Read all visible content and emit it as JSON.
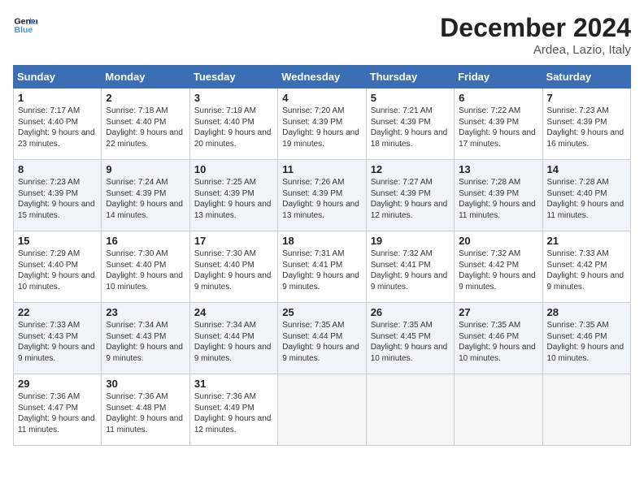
{
  "header": {
    "logo_line1": "General",
    "logo_line2": "Blue",
    "month_title": "December 2024",
    "location": "Ardea, Lazio, Italy"
  },
  "days_of_week": [
    "Sunday",
    "Monday",
    "Tuesday",
    "Wednesday",
    "Thursday",
    "Friday",
    "Saturday"
  ],
  "weeks": [
    [
      {
        "day": 1,
        "sunrise": "7:17 AM",
        "sunset": "4:40 PM",
        "daylight": "9 hours and 23 minutes."
      },
      {
        "day": 2,
        "sunrise": "7:18 AM",
        "sunset": "4:40 PM",
        "daylight": "9 hours and 22 minutes."
      },
      {
        "day": 3,
        "sunrise": "7:19 AM",
        "sunset": "4:40 PM",
        "daylight": "9 hours and 20 minutes."
      },
      {
        "day": 4,
        "sunrise": "7:20 AM",
        "sunset": "4:39 PM",
        "daylight": "9 hours and 19 minutes."
      },
      {
        "day": 5,
        "sunrise": "7:21 AM",
        "sunset": "4:39 PM",
        "daylight": "9 hours and 18 minutes."
      },
      {
        "day": 6,
        "sunrise": "7:22 AM",
        "sunset": "4:39 PM",
        "daylight": "9 hours and 17 minutes."
      },
      {
        "day": 7,
        "sunrise": "7:23 AM",
        "sunset": "4:39 PM",
        "daylight": "9 hours and 16 minutes."
      }
    ],
    [
      {
        "day": 8,
        "sunrise": "7:23 AM",
        "sunset": "4:39 PM",
        "daylight": "9 hours and 15 minutes."
      },
      {
        "day": 9,
        "sunrise": "7:24 AM",
        "sunset": "4:39 PM",
        "daylight": "9 hours and 14 minutes."
      },
      {
        "day": 10,
        "sunrise": "7:25 AM",
        "sunset": "4:39 PM",
        "daylight": "9 hours and 13 minutes."
      },
      {
        "day": 11,
        "sunrise": "7:26 AM",
        "sunset": "4:39 PM",
        "daylight": "9 hours and 13 minutes."
      },
      {
        "day": 12,
        "sunrise": "7:27 AM",
        "sunset": "4:39 PM",
        "daylight": "9 hours and 12 minutes."
      },
      {
        "day": 13,
        "sunrise": "7:28 AM",
        "sunset": "4:39 PM",
        "daylight": "9 hours and 11 minutes."
      },
      {
        "day": 14,
        "sunrise": "7:28 AM",
        "sunset": "4:40 PM",
        "daylight": "9 hours and 11 minutes."
      }
    ],
    [
      {
        "day": 15,
        "sunrise": "7:29 AM",
        "sunset": "4:40 PM",
        "daylight": "9 hours and 10 minutes."
      },
      {
        "day": 16,
        "sunrise": "7:30 AM",
        "sunset": "4:40 PM",
        "daylight": "9 hours and 10 minutes."
      },
      {
        "day": 17,
        "sunrise": "7:30 AM",
        "sunset": "4:40 PM",
        "daylight": "9 hours and 9 minutes."
      },
      {
        "day": 18,
        "sunrise": "7:31 AM",
        "sunset": "4:41 PM",
        "daylight": "9 hours and 9 minutes."
      },
      {
        "day": 19,
        "sunrise": "7:32 AM",
        "sunset": "4:41 PM",
        "daylight": "9 hours and 9 minutes."
      },
      {
        "day": 20,
        "sunrise": "7:32 AM",
        "sunset": "4:42 PM",
        "daylight": "9 hours and 9 minutes."
      },
      {
        "day": 21,
        "sunrise": "7:33 AM",
        "sunset": "4:42 PM",
        "daylight": "9 hours and 9 minutes."
      }
    ],
    [
      {
        "day": 22,
        "sunrise": "7:33 AM",
        "sunset": "4:43 PM",
        "daylight": "9 hours and 9 minutes."
      },
      {
        "day": 23,
        "sunrise": "7:34 AM",
        "sunset": "4:43 PM",
        "daylight": "9 hours and 9 minutes."
      },
      {
        "day": 24,
        "sunrise": "7:34 AM",
        "sunset": "4:44 PM",
        "daylight": "9 hours and 9 minutes."
      },
      {
        "day": 25,
        "sunrise": "7:35 AM",
        "sunset": "4:44 PM",
        "daylight": "9 hours and 9 minutes."
      },
      {
        "day": 26,
        "sunrise": "7:35 AM",
        "sunset": "4:45 PM",
        "daylight": "9 hours and 10 minutes."
      },
      {
        "day": 27,
        "sunrise": "7:35 AM",
        "sunset": "4:46 PM",
        "daylight": "9 hours and 10 minutes."
      },
      {
        "day": 28,
        "sunrise": "7:35 AM",
        "sunset": "4:46 PM",
        "daylight": "9 hours and 10 minutes."
      }
    ],
    [
      {
        "day": 29,
        "sunrise": "7:36 AM",
        "sunset": "4:47 PM",
        "daylight": "9 hours and 11 minutes."
      },
      {
        "day": 30,
        "sunrise": "7:36 AM",
        "sunset": "4:48 PM",
        "daylight": "9 hours and 11 minutes."
      },
      {
        "day": 31,
        "sunrise": "7:36 AM",
        "sunset": "4:49 PM",
        "daylight": "9 hours and 12 minutes."
      },
      null,
      null,
      null,
      null
    ]
  ],
  "labels": {
    "sunrise": "Sunrise:",
    "sunset": "Sunset:",
    "daylight": "Daylight:"
  }
}
